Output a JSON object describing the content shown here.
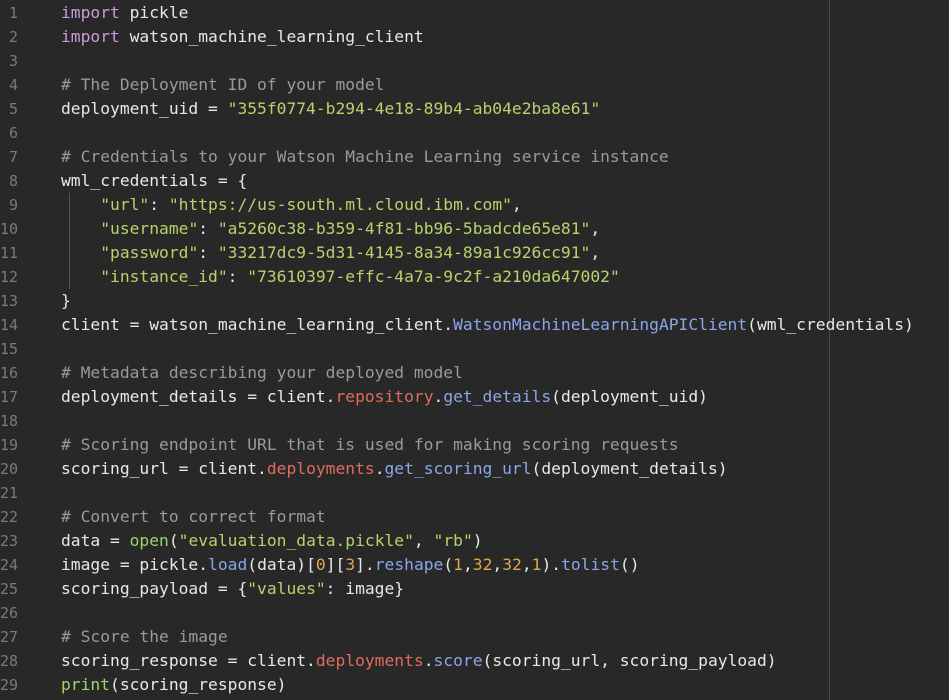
{
  "colors": {
    "background": "#282828",
    "line_number": "#7a7a7a",
    "keyword": "#c79bd8",
    "comment": "#9a9a9a",
    "string": "#b7d36b",
    "function": "#8aa6e8",
    "attribute": "#e06c5c",
    "number": "#e0a74e",
    "builtin": "#9ad66b",
    "plain": "#e8e8e8"
  },
  "lines": [
    {
      "number": "1",
      "tokens": [
        {
          "t": "keyword",
          "v": "import"
        },
        {
          "t": "plain",
          "v": " pickle"
        }
      ]
    },
    {
      "number": "2",
      "tokens": [
        {
          "t": "keyword",
          "v": "import"
        },
        {
          "t": "plain",
          "v": " watson_machine_learning_client"
        }
      ]
    },
    {
      "number": "3",
      "tokens": []
    },
    {
      "number": "4",
      "tokens": [
        {
          "t": "comment",
          "v": "# The Deployment ID of your model"
        }
      ]
    },
    {
      "number": "5",
      "tokens": [
        {
          "t": "plain",
          "v": "deployment_uid = "
        },
        {
          "t": "string",
          "v": "\"355f0774-b294-4e18-89b4-ab04e2ba8e61\""
        }
      ]
    },
    {
      "number": "6",
      "tokens": []
    },
    {
      "number": "7",
      "tokens": [
        {
          "t": "comment",
          "v": "# Credentials to your Watson Machine Learning service instance"
        }
      ]
    },
    {
      "number": "8",
      "tokens": [
        {
          "t": "plain",
          "v": "wml_credentials = {"
        }
      ]
    },
    {
      "number": "9",
      "guide": true,
      "tokens": [
        {
          "t": "plain",
          "v": "    "
        },
        {
          "t": "string",
          "v": "\"url\""
        },
        {
          "t": "plain",
          "v": ": "
        },
        {
          "t": "string",
          "v": "\"https://us-south.ml.cloud.ibm.com\""
        },
        {
          "t": "plain",
          "v": ","
        }
      ]
    },
    {
      "number": "10",
      "guide": true,
      "tokens": [
        {
          "t": "plain",
          "v": "    "
        },
        {
          "t": "string",
          "v": "\"username\""
        },
        {
          "t": "plain",
          "v": ": "
        },
        {
          "t": "string",
          "v": "\"a5260c38-b359-4f81-bb96-5badcde65e81\""
        },
        {
          "t": "plain",
          "v": ","
        }
      ]
    },
    {
      "number": "11",
      "guide": true,
      "tokens": [
        {
          "t": "plain",
          "v": "    "
        },
        {
          "t": "string",
          "v": "\"password\""
        },
        {
          "t": "plain",
          "v": ": "
        },
        {
          "t": "string",
          "v": "\"33217dc9-5d31-4145-8a34-89a1c926cc91\""
        },
        {
          "t": "plain",
          "v": ","
        }
      ]
    },
    {
      "number": "12",
      "guide": true,
      "tokens": [
        {
          "t": "plain",
          "v": "    "
        },
        {
          "t": "string",
          "v": "\"instance_id\""
        },
        {
          "t": "plain",
          "v": ": "
        },
        {
          "t": "string",
          "v": "\"73610397-effc-4a7a-9c2f-a210da647002\""
        }
      ]
    },
    {
      "number": "13",
      "tokens": [
        {
          "t": "plain",
          "v": "}"
        }
      ]
    },
    {
      "number": "14",
      "tokens": [
        {
          "t": "plain",
          "v": "client = watson_machine_learning_client."
        },
        {
          "t": "func",
          "v": "WatsonMachineLearningAPIClient"
        },
        {
          "t": "plain",
          "v": "(wml_credentials)"
        }
      ]
    },
    {
      "number": "15",
      "tokens": []
    },
    {
      "number": "16",
      "tokens": [
        {
          "t": "comment",
          "v": "# Metadata describing your deployed model"
        }
      ]
    },
    {
      "number": "17",
      "tokens": [
        {
          "t": "plain",
          "v": "deployment_details = client."
        },
        {
          "t": "attr",
          "v": "repository"
        },
        {
          "t": "plain",
          "v": "."
        },
        {
          "t": "func",
          "v": "get_details"
        },
        {
          "t": "plain",
          "v": "(deployment_uid)"
        }
      ]
    },
    {
      "number": "18",
      "tokens": []
    },
    {
      "number": "19",
      "tokens": [
        {
          "t": "comment",
          "v": "# Scoring endpoint URL that is used for making scoring requests"
        }
      ]
    },
    {
      "number": "20",
      "tokens": [
        {
          "t": "plain",
          "v": "scoring_url = client."
        },
        {
          "t": "attr",
          "v": "deployments"
        },
        {
          "t": "plain",
          "v": "."
        },
        {
          "t": "func",
          "v": "get_scoring_url"
        },
        {
          "t": "plain",
          "v": "(deployment_details)"
        }
      ]
    },
    {
      "number": "21",
      "tokens": []
    },
    {
      "number": "22",
      "tokens": [
        {
          "t": "comment",
          "v": "# Convert to correct format"
        }
      ]
    },
    {
      "number": "23",
      "tokens": [
        {
          "t": "plain",
          "v": "data = "
        },
        {
          "t": "builtin",
          "v": "open"
        },
        {
          "t": "plain",
          "v": "("
        },
        {
          "t": "string",
          "v": "\"evaluation_data.pickle\""
        },
        {
          "t": "plain",
          "v": ", "
        },
        {
          "t": "string",
          "v": "\"rb\""
        },
        {
          "t": "plain",
          "v": ")"
        }
      ]
    },
    {
      "number": "24",
      "tokens": [
        {
          "t": "plain",
          "v": "image = pickle."
        },
        {
          "t": "func",
          "v": "load"
        },
        {
          "t": "plain",
          "v": "(data)["
        },
        {
          "t": "number",
          "v": "0"
        },
        {
          "t": "plain",
          "v": "]["
        },
        {
          "t": "number",
          "v": "3"
        },
        {
          "t": "plain",
          "v": "]."
        },
        {
          "t": "func",
          "v": "reshape"
        },
        {
          "t": "plain",
          "v": "("
        },
        {
          "t": "number",
          "v": "1"
        },
        {
          "t": "plain",
          "v": ","
        },
        {
          "t": "number",
          "v": "32"
        },
        {
          "t": "plain",
          "v": ","
        },
        {
          "t": "number",
          "v": "32"
        },
        {
          "t": "plain",
          "v": ","
        },
        {
          "t": "number",
          "v": "1"
        },
        {
          "t": "plain",
          "v": ")."
        },
        {
          "t": "func",
          "v": "tolist"
        },
        {
          "t": "plain",
          "v": "()"
        }
      ]
    },
    {
      "number": "25",
      "tokens": [
        {
          "t": "plain",
          "v": "scoring_payload = {"
        },
        {
          "t": "string",
          "v": "\"values\""
        },
        {
          "t": "plain",
          "v": ": image}"
        }
      ]
    },
    {
      "number": "26",
      "tokens": []
    },
    {
      "number": "27",
      "tokens": [
        {
          "t": "comment",
          "v": "# Score the image"
        }
      ]
    },
    {
      "number": "28",
      "tokens": [
        {
          "t": "plain",
          "v": "scoring_response = client."
        },
        {
          "t": "attr",
          "v": "deployments"
        },
        {
          "t": "plain",
          "v": "."
        },
        {
          "t": "func",
          "v": "score"
        },
        {
          "t": "plain",
          "v": "(scoring_url, scoring_payload)"
        }
      ]
    },
    {
      "number": "29",
      "tokens": [
        {
          "t": "builtin",
          "v": "print"
        },
        {
          "t": "plain",
          "v": "(scoring_response)"
        }
      ]
    }
  ]
}
